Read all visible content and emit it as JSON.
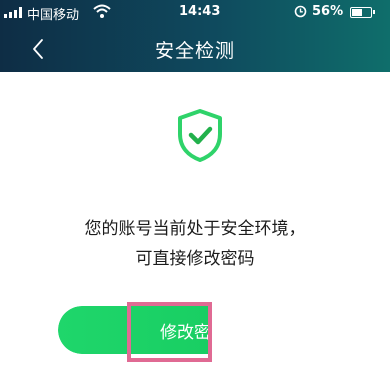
{
  "status_bar": {
    "carrier": "中国移动",
    "time": "14:43",
    "battery": "56%",
    "battery_level": 0.56,
    "icons": [
      "signal-icon",
      "wifi-icon",
      "alarm-icon",
      "battery-icon"
    ]
  },
  "header": {
    "title": "安全检测",
    "back_icon": "chevron-left-icon",
    "gradient": [
      "#0e2d45",
      "#0f4a5e",
      "#0f6e6b"
    ]
  },
  "main": {
    "status_icon": "shield-check-icon",
    "message_line1": "您的账号当前处于安全环境，",
    "message_line2": "可直接修改密码",
    "button_label": "修改密码",
    "accent": "#1fd66b",
    "highlight_color": "#e06a93"
  }
}
